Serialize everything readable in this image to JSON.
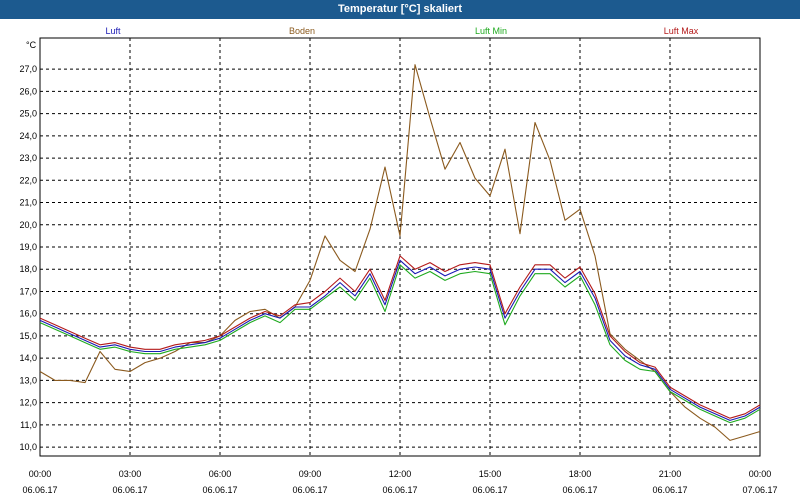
{
  "window": {
    "title": "Temperatur [°C] skaliert"
  },
  "colors": {
    "title_bg": "#1c5a8f",
    "luft": "#1a1ab4",
    "boden": "#8b5a1e",
    "luft_min": "#1faa1f",
    "luft_max": "#b41a1a"
  },
  "chart_data": {
    "type": "line",
    "title": "Temperatur [°C] skaliert",
    "ylabel": "°C",
    "xlabel": "",
    "ylim": [
      9.6,
      28.4
    ],
    "xlim": [
      0,
      24
    ],
    "grid": true,
    "legend_position": "top",
    "y_ticks": [
      "10,0",
      "11,0",
      "12,0",
      "13,0",
      "14,0",
      "15,0",
      "16,0",
      "17,0",
      "18,0",
      "19,0",
      "20,0",
      "21,0",
      "22,0",
      "23,0",
      "24,0",
      "25,0",
      "26,0",
      "27,0"
    ],
    "x_ticks": [
      {
        "time": "00:00",
        "date": "06.06.17"
      },
      {
        "time": "03:00",
        "date": "06.06.17"
      },
      {
        "time": "06:00",
        "date": "06.06.17"
      },
      {
        "time": "09:00",
        "date": "06.06.17"
      },
      {
        "time": "12:00",
        "date": "06.06.17"
      },
      {
        "time": "15:00",
        "date": "06.06.17"
      },
      {
        "time": "18:00",
        "date": "06.06.17"
      },
      {
        "time": "21:00",
        "date": "06.06.17"
      },
      {
        "time": "00:00",
        "date": "07.06.17"
      }
    ],
    "x_hours": [
      0,
      0.5,
      1,
      1.5,
      2,
      2.5,
      3,
      3.5,
      4,
      4.5,
      5,
      5.5,
      6,
      6.5,
      7,
      7.5,
      8,
      8.5,
      9,
      9.5,
      10,
      10.5,
      11,
      11.5,
      12,
      12.5,
      13,
      13.5,
      14,
      14.5,
      15,
      15.5,
      16,
      16.5,
      17,
      17.5,
      18,
      18.5,
      19,
      19.5,
      20,
      20.5,
      21,
      21.5,
      22,
      22.5,
      23,
      23.5,
      24
    ],
    "series": [
      {
        "name": "Luft",
        "color": "#1a1ab4",
        "values": [
          15.7,
          15.4,
          15.1,
          14.8,
          14.5,
          14.6,
          14.4,
          14.3,
          14.3,
          14.5,
          14.6,
          14.7,
          14.9,
          15.3,
          15.7,
          16.0,
          15.8,
          16.3,
          16.3,
          16.8,
          17.4,
          16.8,
          17.8,
          16.4,
          18.4,
          17.8,
          18.1,
          17.7,
          18.0,
          18.1,
          18.0,
          15.8,
          17.0,
          18.0,
          18.0,
          17.4,
          17.9,
          16.7,
          14.8,
          14.1,
          13.7,
          13.5,
          12.6,
          12.2,
          11.8,
          11.5,
          11.2,
          11.4,
          11.8
        ]
      },
      {
        "name": "Boden",
        "color": "#8b5a1e",
        "values": [
          13.4,
          13.0,
          13.0,
          12.9,
          14.3,
          13.5,
          13.4,
          13.8,
          14.0,
          14.3,
          14.7,
          14.7,
          15.0,
          15.7,
          16.1,
          16.2,
          15.8,
          16.3,
          17.5,
          19.5,
          18.4,
          17.9,
          19.8,
          22.6,
          19.5,
          27.2,
          24.8,
          22.5,
          23.7,
          22.1,
          21.3,
          23.4,
          19.6,
          24.6,
          22.9,
          20.2,
          20.7,
          18.6,
          15.1,
          14.4,
          13.9,
          13.4,
          12.5,
          11.8,
          11.3,
          10.9,
          10.3,
          10.5,
          10.7
        ]
      },
      {
        "name": "Luft Min",
        "color": "#1faa1f",
        "values": [
          15.6,
          15.3,
          15.0,
          14.7,
          14.4,
          14.5,
          14.3,
          14.2,
          14.2,
          14.4,
          14.5,
          14.6,
          14.8,
          15.2,
          15.6,
          15.9,
          15.6,
          16.2,
          16.2,
          16.7,
          17.2,
          16.6,
          17.6,
          16.1,
          18.2,
          17.6,
          17.9,
          17.5,
          17.8,
          17.9,
          17.8,
          15.5,
          16.8,
          17.8,
          17.8,
          17.2,
          17.7,
          16.4,
          14.6,
          13.9,
          13.5,
          13.4,
          12.5,
          12.1,
          11.7,
          11.4,
          11.1,
          11.3,
          11.7
        ]
      },
      {
        "name": "Luft Max",
        "color": "#b41a1a",
        "values": [
          15.8,
          15.5,
          15.2,
          14.9,
          14.6,
          14.7,
          14.5,
          14.4,
          14.4,
          14.6,
          14.7,
          14.8,
          15.0,
          15.4,
          15.8,
          16.1,
          15.9,
          16.4,
          16.5,
          17.0,
          17.6,
          17.0,
          18.0,
          16.6,
          18.6,
          18.0,
          18.3,
          17.9,
          18.2,
          18.3,
          18.2,
          16.0,
          17.2,
          18.2,
          18.2,
          17.6,
          18.1,
          16.9,
          15.0,
          14.3,
          13.8,
          13.6,
          12.7,
          12.3,
          11.9,
          11.6,
          11.3,
          11.5,
          11.9
        ]
      }
    ]
  }
}
